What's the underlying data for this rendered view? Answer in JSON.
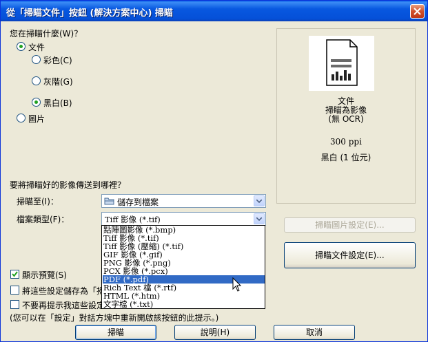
{
  "window": {
    "title": "從「掃瞄文件」按鈕 (解決方案中心) 掃瞄"
  },
  "scan_what": {
    "label": "您在掃瞄什麼(W)？",
    "options": [
      {
        "label": "文件",
        "checked": true
      },
      {
        "label": "彩色(C)",
        "checked": false
      },
      {
        "label": "灰階(G)",
        "checked": false
      },
      {
        "label": "黑白(B)",
        "checked": true
      },
      {
        "label": "圖片",
        "checked": false
      }
    ]
  },
  "preview": {
    "line1": "文件",
    "line2": "掃瞄為影像",
    "line3": "(無 OCR)",
    "resolution": "300 ppi",
    "color_mode": "黑白 (1 位元)"
  },
  "destination": {
    "label": "要將掃瞄好的影像傳送到哪裡？",
    "scan_to_label": "掃瞄至(I)：",
    "scan_to_value": "儲存到檔案",
    "file_type_label": "檔案類型(F)：",
    "file_type_value": "Tiff 影像 (*.tif)"
  },
  "file_types": [
    "點陣圖影像 (*.bmp)",
    "Tiff 影像 (*.tif)",
    "Tiff 影像 (壓縮) (*.tif)",
    "GIF 影像 (*.gif)",
    "PNG 影像 (*.png)",
    "PCX 影像 (*.pcx)",
    "PDF (*.pdf)",
    "Rich Text 檔 (*.rtf)",
    "HTML (*.htm)",
    "文字檔 (*.txt)"
  ],
  "selected_file_type_index": 6,
  "options": {
    "show_preview": "顯示預覽(S)",
    "save_settings": "將這些設定儲存為「掃",
    "dont_prompt": "不要再提示我這些設定",
    "note": "(您可以在「設定」對話方塊中重新開啟該按鈕的此提示。)"
  },
  "buttons": {
    "image_settings": "掃瞄圖片設定(E)...",
    "doc_settings": "掃瞄文件設定(E)...",
    "scan": "掃瞄",
    "help": "說明(H)",
    "cancel": "取消"
  }
}
